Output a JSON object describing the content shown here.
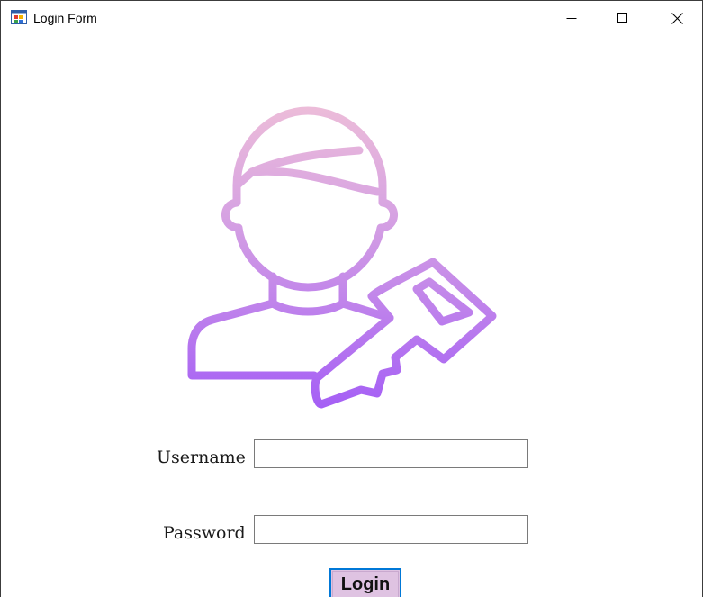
{
  "window": {
    "title": "Login Form",
    "app_icon": "winforms-app-icon",
    "controls": {
      "minimize_icon": "minimize-icon",
      "maximize_icon": "maximize-icon",
      "close_icon": "close-icon"
    }
  },
  "hero": {
    "icon": "user-key-icon",
    "gradient_top": "#ecbcd9",
    "gradient_bottom": "#a55ff5"
  },
  "form": {
    "username_label": "Username",
    "username_value": "",
    "password_label": "Password",
    "password_value": "",
    "login_label": "Login"
  },
  "colors": {
    "button_bg": "#dfc3e2",
    "button_focus_border": "#0078d7"
  }
}
